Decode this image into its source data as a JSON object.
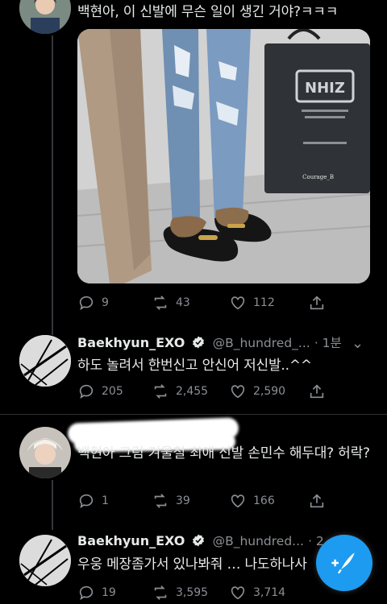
{
  "tweet1": {
    "text": "백현아, 이 신발에 무슨 일이 생긴 거야?ㅋㅋㅋ",
    "image_brand": "NHIZ",
    "image_watermark": "Courage_B",
    "replies": "9",
    "retweets": "43",
    "likes": "112"
  },
  "tweet2": {
    "name": "Baekhyun_EXO",
    "handle": "@B_hundred_...",
    "time": "· 1분",
    "text": "하도 놀려서 한번신고 안신어 저신발..^^",
    "replies": "205",
    "retweets": "2,455",
    "likes": "2,590"
  },
  "tweet3": {
    "text": "백현아 그럼 겨울철 최애 신발 손민수 해두대? 허락?",
    "replies": "1",
    "retweets": "39",
    "likes": "166"
  },
  "tweet4": {
    "name": "Baekhyun_EXO",
    "handle": "@B_hundred...",
    "time": "· 2",
    "text": "우웅 메장좀가서 있나봐줘 … 나도하나사",
    "replies": "19",
    "retweets": "3,595",
    "likes": "3,714"
  },
  "colors": {
    "accent": "#1d9bf0",
    "secondary_text": "#8b8f94"
  }
}
